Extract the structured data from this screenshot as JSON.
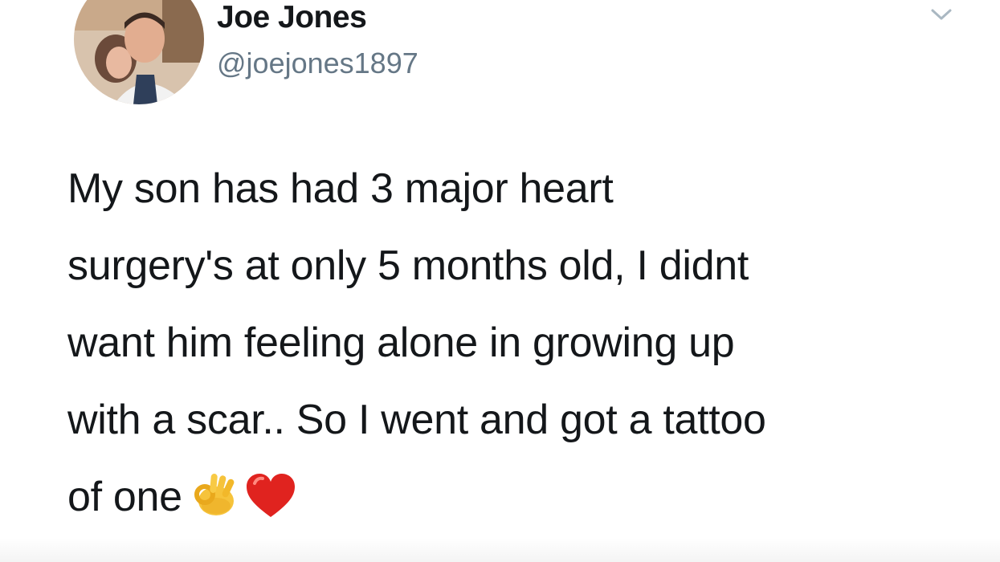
{
  "author": {
    "display_name": "Joe Jones",
    "handle": "@joejones1897",
    "avatar_icon": "profile-photo"
  },
  "tweet": {
    "lines": [
      "My son has had 3 major heart",
      "surgery's at only 5 months old, I didnt",
      "want him feeling alone in growing up",
      "with a scar.. So I went and got a tattoo",
      "of one"
    ],
    "emojis": [
      "ok-hand-emoji",
      "red-heart-emoji"
    ]
  },
  "menu": {
    "icon": "chevron-down-icon"
  },
  "colors": {
    "text": "#14171a",
    "handle": "#657786",
    "background": "#ffffff"
  }
}
